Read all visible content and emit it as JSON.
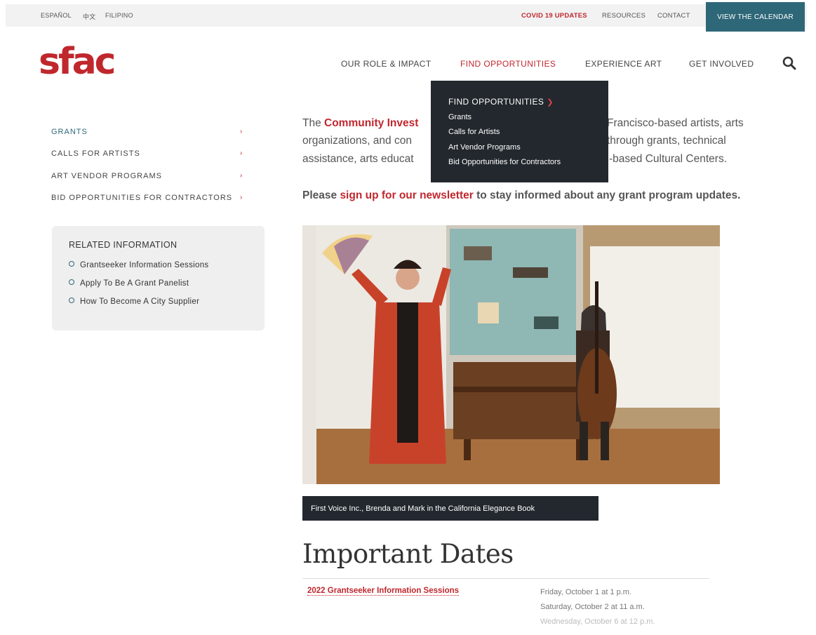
{
  "utility_bar": {
    "languages": [
      "ESPAÑOL",
      "中文",
      "FILIPINO"
    ],
    "links": [
      "COVID 19 UPDATES",
      "RESOURCES",
      "CONTACT"
    ],
    "calendar_button": "VIEW THE CALENDAR"
  },
  "logo": "sfac",
  "nav": {
    "items": [
      "OUR ROLE & IMPACT",
      "FIND OPPORTUNITIES",
      "EXPERIENCE ART",
      "GET INVOLVED"
    ],
    "active": "FIND OPPORTUNITIES"
  },
  "dropdown": {
    "title": "FIND OPPORTUNITIES",
    "items": [
      "Grants",
      "Calls for Artists",
      "Art Vendor Programs",
      "Bid Opportunities for Contractors"
    ]
  },
  "sidebar": {
    "items": [
      "GRANTS",
      "CALLS FOR ARTISTS",
      "ART VENDOR PROGRAMS",
      "BID OPPORTUNITIES FOR CONTRACTORS"
    ],
    "related": {
      "title": "RELATED INFORMATION",
      "links": [
        "Grantseeker Information Sessions",
        "Apply To Be A Grant Panelist",
        "How To Become A City Supplier"
      ]
    }
  },
  "intro": {
    "line1_prefix": "The ",
    "line1_link": "Community Invest",
    "line1_suffix": "Francisco-based artists, arts",
    "line2_prefix": "organizations, and con",
    "line2_suffix": "through grants, technical",
    "line3_prefix": "assistance, arts educat",
    "line3_suffix": "-based Cultural Centers."
  },
  "newsletter": {
    "prefix": "Please ",
    "link": "sign up for our newsletter",
    "suffix": " to stay informed about any grant program updates."
  },
  "photo_caption": "First Voice Inc., Brenda and Mark in the California Elegance Book",
  "important_dates": {
    "title": "Important Dates",
    "event": "2022 Grantseeker Information Sessions",
    "times": [
      "Friday, October 1 at 1 p.m.",
      "Saturday, October 2 at 11 a.m.",
      "Wednesday, October 6 at 12 p.m."
    ]
  }
}
